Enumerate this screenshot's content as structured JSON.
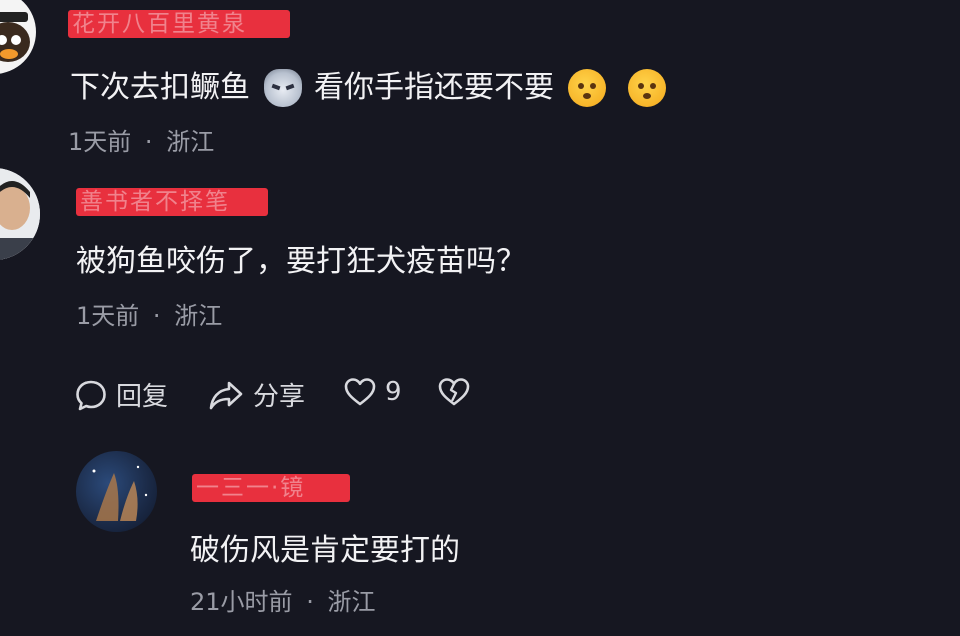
{
  "comments": [
    {
      "author": "花开八百里黄泉",
      "text_before": "下次去扣鳜鱼",
      "text_after": "看你手指还要不要",
      "time": "1天前",
      "location": "浙江",
      "separator": "·"
    },
    {
      "author": "善书者不择笔",
      "text": "被狗鱼咬伤了，要打狂犬疫苗吗？",
      "time": "1天前",
      "location": "浙江",
      "separator": "·",
      "actions": {
        "reply_label": "回复",
        "share_label": "分享",
        "like_count": "9"
      }
    },
    {
      "author": "一三一·镜",
      "text": "破伤风是肯定要打的",
      "time": "21小时前",
      "location": "浙江",
      "separator": "·"
    }
  ],
  "icons": {
    "reply": "chat-bubble-icon",
    "share": "share-arrow-icon",
    "like": "heart-icon",
    "dislike": "broken-heart-icon"
  },
  "colors": {
    "background": "#161721",
    "redaction": "#e8303e",
    "meta_text": "#9a9ca6"
  }
}
